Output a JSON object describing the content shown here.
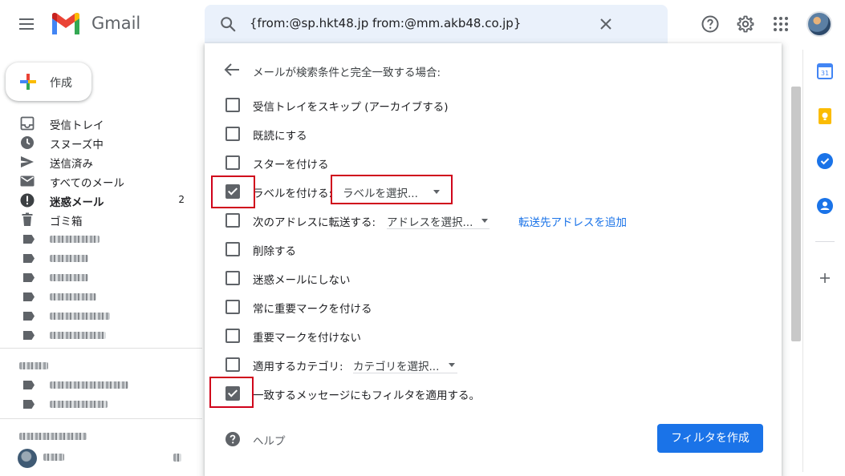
{
  "app": {
    "name": "Gmail"
  },
  "search": {
    "query": "{from:@sp.hkt48.jp from:@mm.akb48.co.jp}"
  },
  "sidebar": {
    "compose_label": "作成",
    "items": [
      {
        "label": "受信トレイ",
        "icon": "inbox-icon"
      },
      {
        "label": "スヌーズ中",
        "icon": "clock-icon"
      },
      {
        "label": "送信済み",
        "icon": "send-icon"
      },
      {
        "label": "すべてのメール",
        "icon": "mail-icon"
      },
      {
        "label": "迷惑メール",
        "icon": "spam-icon",
        "count": "2",
        "bold": true
      },
      {
        "label": "ゴミ箱",
        "icon": "trash-icon"
      }
    ]
  },
  "filter": {
    "title": "メールが検索条件と完全一致する場合:",
    "options": [
      {
        "label": "受信トレイをスキップ (アーカイブする)",
        "checked": false
      },
      {
        "label": "既読にする",
        "checked": false
      },
      {
        "label": "スターを付ける",
        "checked": false
      },
      {
        "label": "ラベルを付ける:",
        "checked": true,
        "dropdown": "ラベルを選択..."
      },
      {
        "label": "次のアドレスに転送する:",
        "checked": false,
        "dropdown": "アドレスを選択...",
        "link": "転送先アドレスを追加"
      },
      {
        "label": "削除する",
        "checked": false
      },
      {
        "label": "迷惑メールにしない",
        "checked": false
      },
      {
        "label": "常に重要マークを付ける",
        "checked": false
      },
      {
        "label": "重要マークを付けない",
        "checked": false
      },
      {
        "label": "適用するカテゴリ:",
        "checked": false,
        "dropdown": "カテゴリを選択..."
      },
      {
        "label": "一致するメッセージにもフィルタを適用する。",
        "checked": true
      }
    ],
    "help_label": "ヘルプ",
    "create_button": "フィルタを作成"
  },
  "colors": {
    "accent": "#1a73e8",
    "highlight_box": "#d0021b",
    "search_bg": "#eaf1fb"
  }
}
